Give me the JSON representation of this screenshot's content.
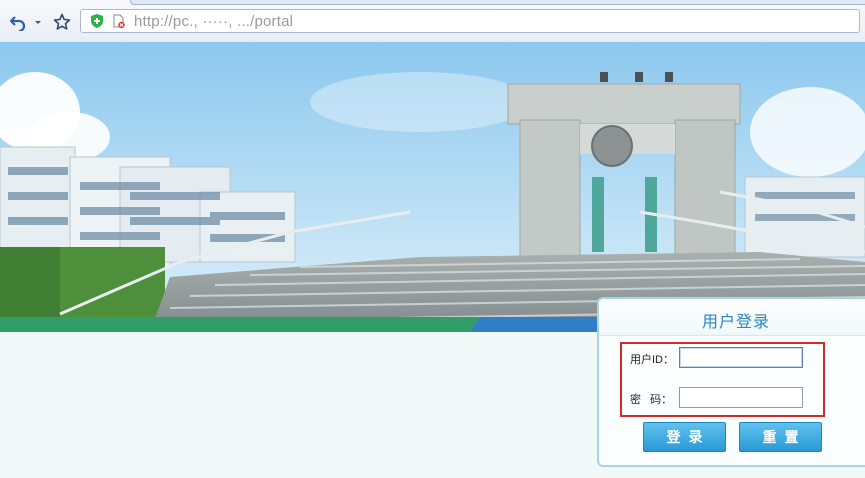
{
  "browser": {
    "url": "http://pc.,                 ·····,      .../portal",
    "icons": [
      "undo-icon",
      "dropdown-arrow-icon",
      "favorite-star-icon",
      "shield-plus-icon",
      "page-security-icon"
    ]
  },
  "login": {
    "title": "用户登录",
    "user_label": "用户ID：",
    "user_value": "",
    "password_label": "密   码：",
    "password_value": "",
    "login_button": "登录",
    "reset_button": "重置"
  },
  "colors": {
    "accent": "#2e86c1",
    "button": "#2a9ad6",
    "highlight": "#d42a2a",
    "page_bg": "#f1f9f9"
  }
}
